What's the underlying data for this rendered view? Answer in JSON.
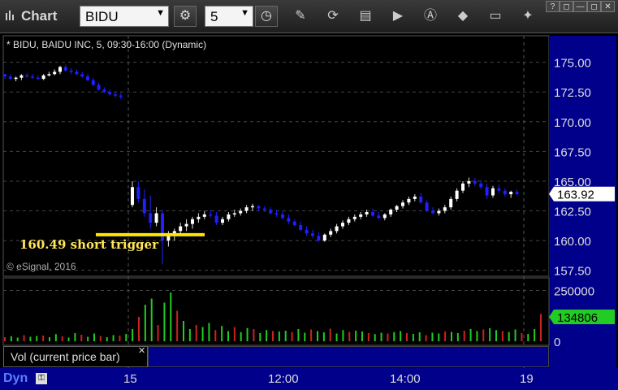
{
  "app": {
    "title": "Chart"
  },
  "toolbar": {
    "symbol": "BIDU",
    "interval": "5"
  },
  "window_buttons": [
    "?",
    "◻",
    "—",
    "◻",
    "✕"
  ],
  "chart": {
    "legend": "* BIDU, BAIDU INC, 5, 09:30-16:00 (Dynamic)",
    "copyright": "© eSignal, 2016",
    "annotation": "160.49 short trigger",
    "current_price": "163.92",
    "price_ticks": [
      "175.00",
      "172.50",
      "170.00",
      "167.50",
      "165.00",
      "162.50",
      "160.00",
      "157.50"
    ],
    "volume_ticks": [
      "250000",
      "0"
    ],
    "current_volume": "134806",
    "volume_study": "Vol (current price bar)",
    "x_ticks": [
      "15",
      "12:00",
      "14:00",
      "19"
    ],
    "dyn_label": "Dyn",
    "colors": {
      "up_candle": "#ffffff",
      "down_candle": "#1f1fff",
      "accent": "#ffe500",
      "axis_bg": "#00008a",
      "vol_up": "#22cc22",
      "vol_down": "#cc2222",
      "price_tag_bg": "#ffffff",
      "vol_tag_bg": "#22cc22"
    }
  },
  "chart_data": {
    "type": "candlestick",
    "ylim": [
      157.0,
      176.0
    ],
    "series": [
      {
        "name": "prior-day",
        "bars": [
          [
            174.0,
            174.0,
            173.6,
            173.8
          ],
          [
            173.8,
            174.0,
            173.5,
            173.6
          ],
          [
            173.6,
            173.8,
            173.4,
            173.7
          ],
          [
            173.7,
            174.0,
            173.5,
            173.9
          ],
          [
            173.9,
            174.1,
            173.7,
            173.8
          ],
          [
            173.8,
            174.0,
            173.6,
            173.7
          ],
          [
            173.7,
            173.9,
            173.5,
            173.6
          ],
          [
            173.6,
            174.0,
            173.5,
            173.9
          ],
          [
            173.9,
            174.2,
            173.8,
            174.0
          ],
          [
            174.0,
            174.4,
            173.9,
            174.2
          ],
          [
            174.2,
            174.7,
            174.0,
            174.6
          ],
          [
            174.6,
            174.8,
            174.2,
            174.3
          ],
          [
            174.3,
            174.5,
            174.0,
            174.2
          ],
          [
            174.2,
            174.4,
            173.9,
            174.0
          ],
          [
            174.0,
            174.2,
            173.7,
            173.8
          ],
          [
            173.8,
            174.0,
            173.4,
            173.5
          ],
          [
            173.5,
            173.7,
            173.0,
            173.1
          ],
          [
            173.1,
            173.3,
            172.6,
            172.7
          ],
          [
            172.7,
            172.9,
            172.4,
            172.5
          ],
          [
            172.5,
            172.7,
            172.2,
            172.3
          ],
          [
            172.3,
            172.5,
            172.0,
            172.2
          ],
          [
            172.2,
            172.4,
            171.9,
            172.1
          ]
        ]
      },
      {
        "name": "day",
        "bars": [
          [
            163.0,
            165.0,
            162.8,
            164.5
          ],
          [
            164.5,
            165.0,
            163.2,
            163.5
          ],
          [
            163.5,
            164.3,
            162.0,
            162.3
          ],
          [
            162.3,
            163.8,
            161.0,
            161.5
          ],
          [
            161.5,
            162.8,
            161.2,
            162.3
          ],
          [
            162.3,
            162.6,
            158.0,
            160.0
          ],
          [
            160.0,
            160.8,
            159.5,
            160.4
          ],
          [
            160.4,
            161.0,
            160.0,
            160.8
          ],
          [
            160.8,
            161.5,
            160.5,
            161.2
          ],
          [
            161.2,
            161.8,
            160.8,
            161.4
          ],
          [
            161.4,
            162.0,
            161.0,
            161.8
          ],
          [
            161.8,
            162.3,
            161.5,
            162.0
          ],
          [
            162.0,
            162.5,
            161.8,
            162.2
          ],
          [
            162.2,
            162.6,
            161.9,
            162.1
          ],
          [
            162.1,
            162.4,
            161.3,
            161.5
          ],
          [
            161.5,
            162.0,
            161.3,
            161.8
          ],
          [
            161.8,
            162.4,
            161.6,
            162.2
          ],
          [
            162.2,
            162.6,
            162.0,
            162.3
          ],
          [
            162.3,
            162.7,
            162.1,
            162.5
          ],
          [
            162.5,
            163.0,
            162.3,
            162.8
          ],
          [
            162.8,
            163.1,
            162.5,
            162.9
          ],
          [
            162.9,
            163.0,
            162.5,
            162.7
          ],
          [
            162.7,
            162.9,
            162.4,
            162.6
          ],
          [
            162.6,
            162.8,
            162.2,
            162.3
          ],
          [
            162.3,
            162.6,
            162.0,
            162.2
          ],
          [
            162.2,
            162.5,
            161.8,
            161.9
          ],
          [
            161.9,
            162.2,
            161.4,
            161.6
          ],
          [
            161.6,
            161.8,
            161.2,
            161.3
          ],
          [
            161.3,
            161.6,
            160.8,
            160.9
          ],
          [
            160.9,
            161.2,
            160.4,
            160.6
          ],
          [
            160.6,
            160.9,
            160.2,
            160.4
          ],
          [
            160.4,
            160.7,
            159.9,
            160.0
          ],
          [
            160.0,
            160.6,
            159.9,
            160.5
          ],
          [
            160.5,
            161.0,
            160.3,
            160.8
          ],
          [
            160.8,
            161.4,
            160.6,
            161.2
          ],
          [
            161.2,
            161.7,
            161.0,
            161.5
          ],
          [
            161.5,
            162.0,
            161.3,
            161.8
          ],
          [
            161.8,
            162.2,
            161.6,
            162.0
          ],
          [
            162.0,
            162.4,
            161.8,
            162.2
          ],
          [
            162.2,
            162.6,
            162.0,
            162.4
          ],
          [
            162.4,
            162.7,
            162.0,
            162.1
          ],
          [
            162.1,
            162.4,
            161.8,
            161.9
          ],
          [
            161.9,
            162.3,
            161.7,
            162.2
          ],
          [
            162.2,
            162.7,
            162.0,
            162.6
          ],
          [
            162.6,
            163.0,
            162.4,
            162.9
          ],
          [
            162.9,
            163.4,
            162.7,
            163.2
          ],
          [
            163.2,
            163.7,
            163.0,
            163.5
          ],
          [
            163.5,
            163.9,
            163.3,
            163.7
          ],
          [
            163.7,
            164.0,
            163.1,
            163.2
          ],
          [
            163.2,
            163.4,
            162.4,
            162.5
          ],
          [
            162.5,
            162.8,
            162.2,
            162.3
          ],
          [
            162.3,
            162.7,
            162.1,
            162.5
          ],
          [
            162.5,
            163.0,
            162.3,
            162.8
          ],
          [
            162.8,
            163.7,
            162.6,
            163.5
          ],
          [
            163.5,
            164.4,
            163.3,
            164.2
          ],
          [
            164.2,
            165.0,
            164.0,
            164.8
          ],
          [
            164.8,
            165.3,
            164.5,
            165.0
          ],
          [
            165.0,
            165.3,
            164.6,
            164.8
          ],
          [
            164.8,
            165.1,
            164.3,
            164.5
          ],
          [
            164.5,
            164.8,
            163.5,
            163.8
          ],
          [
            163.8,
            164.6,
            163.6,
            164.4
          ],
          [
            164.4,
            164.7,
            164.0,
            164.2
          ],
          [
            164.2,
            164.4,
            163.7,
            163.9
          ],
          [
            163.9,
            164.2,
            163.6,
            164.1
          ],
          [
            164.1,
            164.3,
            163.8,
            163.92
          ]
        ]
      }
    ],
    "volume": {
      "ylim": [
        0,
        300000
      ],
      "values": [
        20000,
        25000,
        18000,
        30000,
        22000,
        26000,
        28000,
        20000,
        35000,
        24000,
        18000,
        40000,
        32000,
        22000,
        38000,
        26000,
        20000,
        30000,
        28000,
        36000,
        60000,
        120000,
        180000,
        210000,
        80000,
        190000,
        240000,
        150000,
        100000,
        60000,
        80000,
        70000,
        90000,
        55000,
        75000,
        50000,
        70000,
        45000,
        65000,
        60000,
        40000,
        55000,
        50000,
        48000,
        52000,
        45000,
        60000,
        42000,
        58000,
        50000,
        44000,
        62000,
        38000,
        55000,
        46000,
        52000,
        48000,
        40000,
        35000,
        42000,
        38000,
        45000,
        50000,
        40000,
        36000,
        44000,
        30000,
        42000,
        38000,
        48000,
        46000,
        40000,
        52000,
        60000,
        50000,
        58000,
        64000,
        55000,
        50000,
        45000,
        58000,
        40000,
        36000,
        60000,
        134806
      ]
    }
  }
}
